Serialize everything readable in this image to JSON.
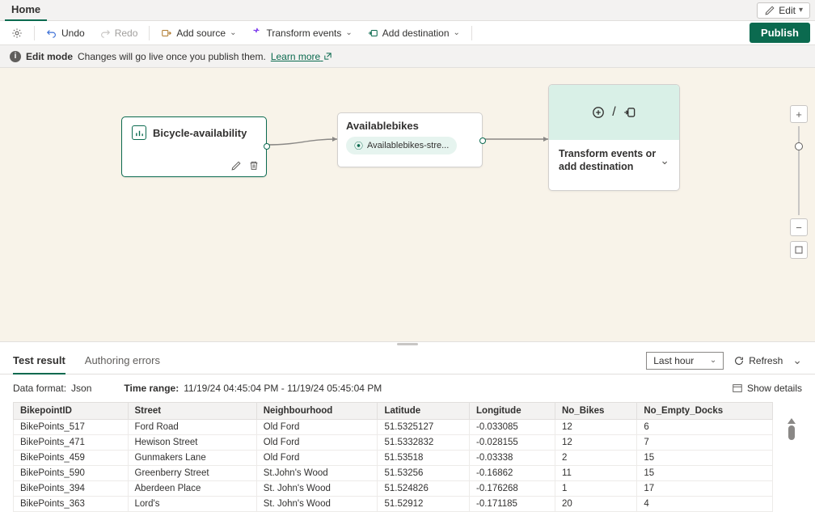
{
  "tabbar": {
    "home": "Home",
    "edit": "Edit"
  },
  "toolbar": {
    "undo": "Undo",
    "redo": "Redo",
    "addSource": "Add source",
    "transformEvents": "Transform events",
    "addDestination": "Add destination",
    "publish": "Publish"
  },
  "banner": {
    "mode": "Edit mode",
    "msg": "Changes will go live once you publish them.",
    "learn": "Learn more"
  },
  "canvas": {
    "source": {
      "title": "Bicycle-availability"
    },
    "mid": {
      "title": "Availablebikes",
      "chip": "Availablebikes-stre..."
    },
    "dest": {
      "text": "Transform events or add destination"
    }
  },
  "results": {
    "tabs": {
      "test": "Test result",
      "errors": "Authoring errors"
    },
    "timeSelect": "Last hour",
    "refresh": "Refresh",
    "dataFormatLabel": "Data format:",
    "dataFormatValue": "Json",
    "timeRangeLabel": "Time range:",
    "timeRangeValue": "11/19/24 04:45:04 PM - 11/19/24 05:45:04 PM",
    "showDetails": "Show details",
    "columns": [
      "BikepointID",
      "Street",
      "Neighbourhood",
      "Latitude",
      "Longitude",
      "No_Bikes",
      "No_Empty_Docks"
    ],
    "rows": [
      [
        "BikePoints_517",
        "Ford Road",
        "Old Ford",
        "51.5325127",
        "-0.033085",
        "12",
        "6"
      ],
      [
        "BikePoints_471",
        "Hewison Street",
        "Old Ford",
        "51.5332832",
        "-0.028155",
        "12",
        "7"
      ],
      [
        "BikePoints_459",
        "Gunmakers Lane",
        "Old Ford",
        "51.53518",
        "-0.03338",
        "2",
        "15"
      ],
      [
        "BikePoints_590",
        "Greenberry Street",
        "St.John's Wood",
        "51.53256",
        "-0.16862",
        "11",
        "15"
      ],
      [
        "BikePoints_394",
        "Aberdeen Place",
        "St. John's Wood",
        "51.524826",
        "-0.176268",
        "1",
        "17"
      ],
      [
        "BikePoints_363",
        "Lord's",
        "St. John's Wood",
        "51.52912",
        "-0.171185",
        "20",
        "4"
      ]
    ]
  }
}
